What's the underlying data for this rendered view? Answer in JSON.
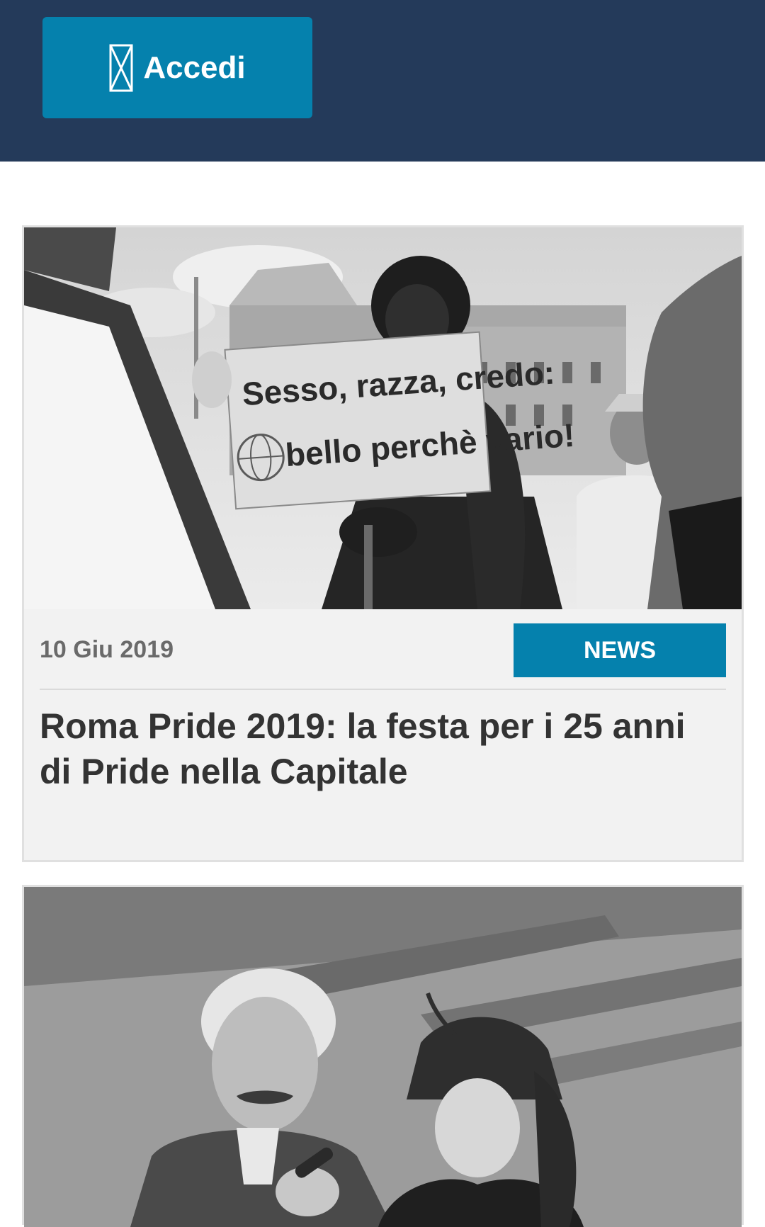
{
  "header": {
    "login_label": "Accedi",
    "login_icon": "hourglass-icon",
    "background_color": "#243a5a",
    "button_color": "#0581ad"
  },
  "articles": [
    {
      "date": "10 Giu 2019",
      "category": "NEWS",
      "title": "Roma Pride 2019: la festa per i 25 anni di Pride nella Capitale",
      "image": {
        "sign_line_1": "Sesso, razza, credo:",
        "sign_line_2": "bello perchè vario!"
      }
    },
    {
      "date": "",
      "category": "",
      "title": "",
      "image": {}
    }
  ]
}
